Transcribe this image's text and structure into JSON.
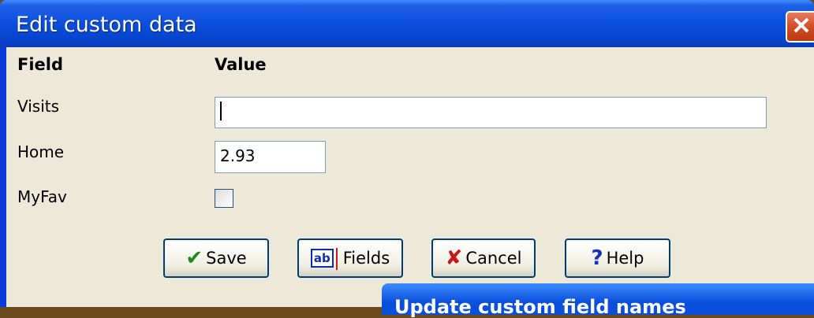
{
  "window": {
    "title": "Edit custom data",
    "close_label": "✕"
  },
  "grid": {
    "field_header": "Field",
    "value_header": "Value",
    "rows": [
      {
        "label": "Visits",
        "value": ""
      },
      {
        "label": "Home",
        "value": "2.93"
      },
      {
        "label": "MyFav",
        "checked": false
      }
    ]
  },
  "buttons": {
    "save": "Save",
    "fields": "Fields",
    "fields_icon_text": "ab",
    "cancel": "Cancel",
    "help": "Help"
  },
  "icons": {
    "save": "checkmark-icon",
    "fields": "text-field-icon",
    "cancel": "x-icon",
    "help": "question-icon"
  },
  "colors": {
    "title_bar": "#0a4fdc",
    "dialog_bg": "#ece9d8",
    "close": "#d04a22"
  },
  "background_dialog": {
    "title": "Update custom field names"
  }
}
